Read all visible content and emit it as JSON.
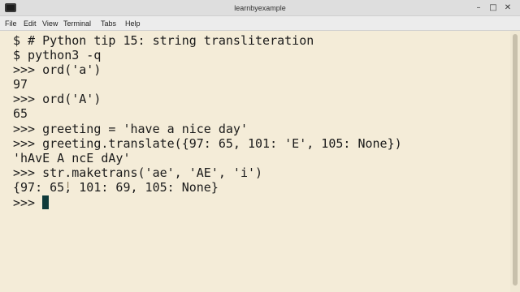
{
  "window": {
    "title": "learnbyexample",
    "buttons": {
      "minimize": "–",
      "maximize": "□",
      "close": "✕"
    }
  },
  "menu": {
    "items": [
      "File",
      "Edit",
      "View",
      "Terminal",
      "Tabs",
      "Help"
    ]
  },
  "terminal": {
    "lines": [
      "$ # Python tip 15: string transliteration",
      "$ python3 -q",
      ">>> ord('a')",
      "97",
      ">>> ord('A')",
      "65",
      ">>> greeting = 'have a nice day'",
      ">>> greeting.translate({97: 65, 101: 'E', 105: None})",
      "'hAvE A ncE dAy'",
      ">>> str.maketrans('ae', 'AE', 'i')",
      "{97: 65, 101: 69, 105: None}",
      ">>> "
    ],
    "colors": {
      "background": "#f4ecd8",
      "text": "#1a1a1a",
      "cursor": "#0f3a3a"
    }
  }
}
